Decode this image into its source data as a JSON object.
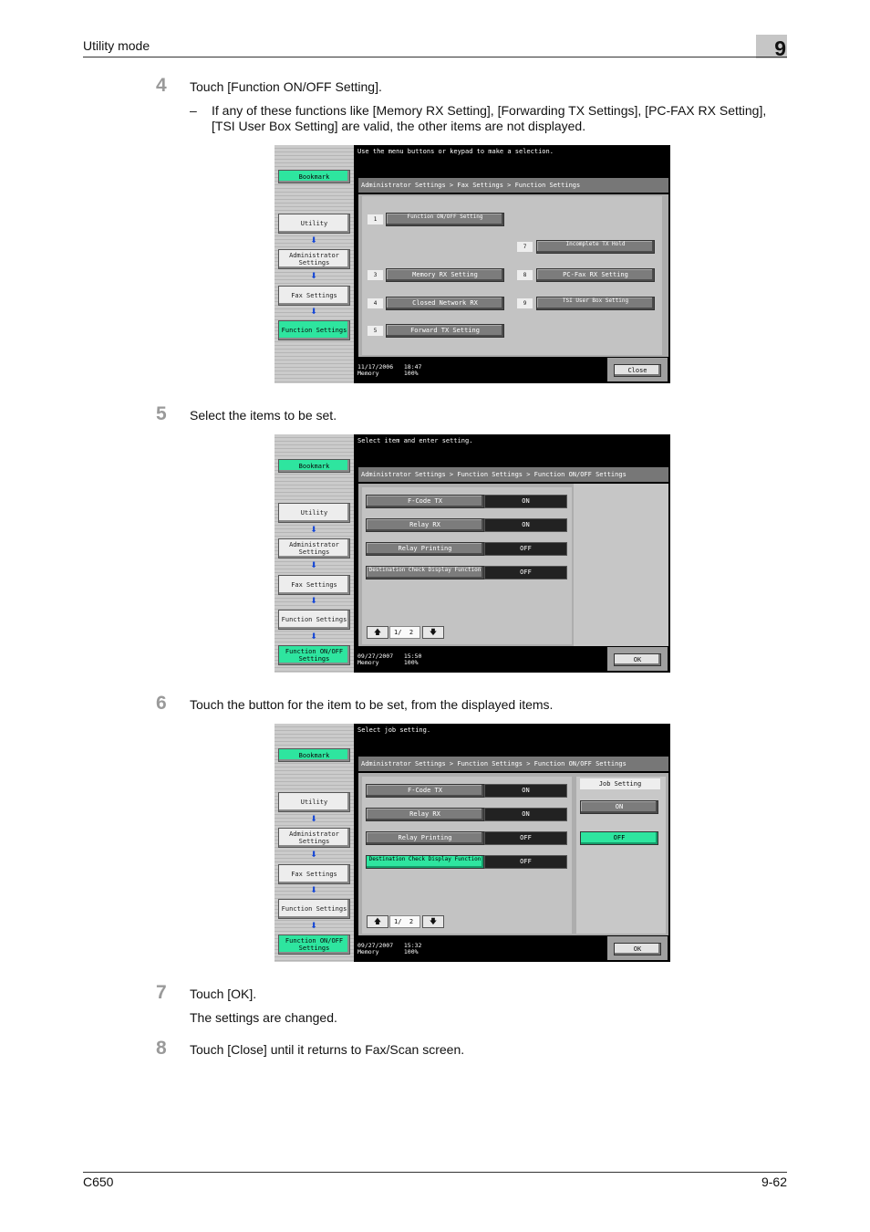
{
  "header": {
    "title": "Utility mode",
    "chapter": "9"
  },
  "footer": {
    "model": "C650",
    "page": "9-62"
  },
  "steps": [
    {
      "num": "4",
      "text": "Touch [Function ON/OFF Setting].",
      "sub": "If any of these functions like [Memory RX Setting], [Forwarding TX Settings], [PC-FAX RX Setting], [TSI User Box Setting] are valid, the other items are not displayed.",
      "dash": "–"
    },
    {
      "num": "5",
      "text": "Select the items to be set."
    },
    {
      "num": "6",
      "text": "Touch the button for the item to be set, from the displayed items."
    },
    {
      "num": "7",
      "text": "Touch [OK].",
      "note": "The settings are changed."
    },
    {
      "num": "8",
      "text": "Touch [Close] until it returns to Fax/Scan screen."
    }
  ],
  "screen1": {
    "message": "Use the menu buttons or keypad to make a selection.",
    "breadcrumb": "Administrator Settings > Fax Settings > Function Settings",
    "sidebar": {
      "bookmark": "Bookmark",
      "utility": "Utility",
      "admin": "Administrator Settings",
      "fax": "Fax Settings",
      "function": "Function Settings"
    },
    "items": [
      {
        "num": "1",
        "label": "Function ON/OFF Setting"
      },
      {
        "num": "7",
        "label": "Incomplete TX Hold"
      },
      {
        "num": "3",
        "label": "Memory RX Setting"
      },
      {
        "num": "8",
        "label": "PC-Fax RX Setting"
      },
      {
        "num": "4",
        "label": "Closed Network RX"
      },
      {
        "num": "9",
        "label": "TSI User Box Setting"
      },
      {
        "num": "5",
        "label": "Forward TX Setting"
      }
    ],
    "date": "11/17/2006",
    "time": "18:47",
    "memory_label": "Memory",
    "memory": "100%",
    "close": "Close"
  },
  "screen2": {
    "message": "Select item and enter setting.",
    "breadcrumb": "Administrator Settings > Function Settings > Function ON/OFF Settings",
    "sidebar": {
      "bookmark": "Bookmark",
      "utility": "Utility",
      "admin": "Administrator Settings",
      "fax": "Fax Settings",
      "function": "Function Settings",
      "onoff": "Function ON/OFF Settings"
    },
    "rows": [
      {
        "label": "F-Code TX",
        "value": "ON"
      },
      {
        "label": "Relay RX",
        "value": "ON"
      },
      {
        "label": "Relay Printing",
        "value": "OFF"
      },
      {
        "label": "Destination Check Display Function",
        "value": "OFF"
      }
    ],
    "page": "1/",
    "pages": "2",
    "date": "09/27/2007",
    "time": "15:50",
    "memory_label": "Memory",
    "memory": "100%",
    "ok": "OK"
  },
  "screen3": {
    "message": "Select job setting.",
    "breadcrumb": "Administrator Settings > Function Settings > Function ON/OFF Settings",
    "sidebar": {
      "bookmark": "Bookmark",
      "utility": "Utility",
      "admin": "Administrator Settings",
      "fax": "Fax Settings",
      "function": "Function Settings",
      "onoff": "Function ON/OFF Settings"
    },
    "rows": [
      {
        "label": "F-Code TX",
        "value": "ON"
      },
      {
        "label": "Relay RX",
        "value": "ON"
      },
      {
        "label": "Relay Printing",
        "value": "OFF"
      },
      {
        "label": "Destination Check Display Function",
        "value": "OFF"
      }
    ],
    "job": {
      "title": "Job Setting",
      "on": "ON",
      "off": "OFF"
    },
    "page": "1/",
    "pages": "2",
    "date": "09/27/2007",
    "time": "15:32",
    "memory_label": "Memory",
    "memory": "100%",
    "ok": "OK"
  },
  "colors": {
    "accent_green": "#2ee59f",
    "arrow_blue": "#1446d6"
  }
}
